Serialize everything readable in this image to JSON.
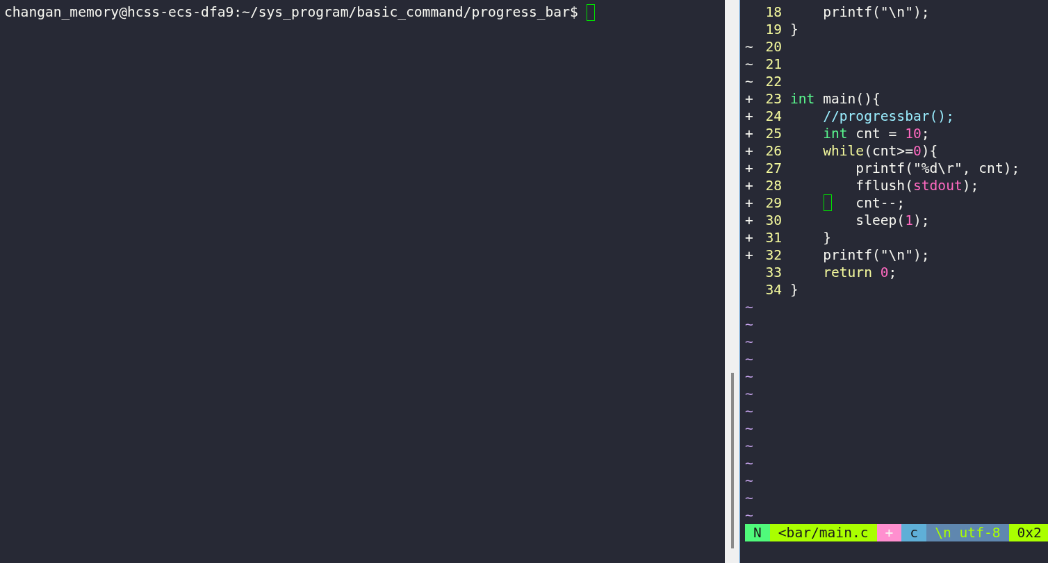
{
  "terminal": {
    "prompt": "changan_memory@hcss-ecs-dfa9:~/sys_program/basic_command/progress_bar$",
    "cursor": true
  },
  "editor": {
    "lines": [
      {
        "number": "18",
        "tokens": [
          {
            "text": "    printf(\"\\n\");",
            "kind": "plain"
          }
        ]
      },
      {
        "number": "19",
        "tokens": [
          {
            "text": "}",
            "kind": "plain"
          }
        ]
      },
      {
        "sign": "~",
        "number": "20"
      },
      {
        "sign": "~",
        "number": "21"
      },
      {
        "sign": "~",
        "number": "22"
      },
      {
        "sign": "+",
        "number": "23",
        "tokens": [
          {
            "text": "int",
            "kind": "type"
          },
          {
            "text": " main(){",
            "kind": "plain"
          }
        ]
      },
      {
        "sign": "+",
        "number": "24",
        "tokens": [
          {
            "text": "    //progressbar();",
            "kind": "comment"
          }
        ]
      },
      {
        "sign": "+",
        "number": "25",
        "tokens": [
          {
            "text": "    int",
            "kind": "type"
          },
          {
            "text": " cnt = ",
            "kind": "plain"
          },
          {
            "text": "10",
            "kind": "number"
          },
          {
            "text": ";",
            "kind": "plain"
          }
        ]
      },
      {
        "sign": "+",
        "number": "26",
        "tokens": [
          {
            "text": "    while",
            "kind": "keyword"
          },
          {
            "text": "(cnt>=",
            "kind": "plain"
          },
          {
            "text": "0",
            "kind": "number"
          },
          {
            "text": "){",
            "kind": "plain"
          }
        ]
      },
      {
        "sign": "+",
        "number": "27",
        "tokens": [
          {
            "text": "        printf(\"%d\\r\", cnt);",
            "kind": "plain"
          }
        ]
      },
      {
        "sign": "+",
        "number": "28",
        "tokens": [
          {
            "text": "        fflush(",
            "kind": "plain"
          },
          {
            "text": "stdout",
            "kind": "number"
          },
          {
            "text": ");",
            "kind": "plain"
          }
        ]
      },
      {
        "sign": "+",
        "number": "29",
        "cursor": true,
        "tokens": [
          {
            "text": "        cnt--;",
            "kind": "plain"
          }
        ]
      },
      {
        "sign": "+",
        "number": "30",
        "tokens": [
          {
            "text": "        sleep(",
            "kind": "plain"
          },
          {
            "text": "1",
            "kind": "number"
          },
          {
            "text": ");",
            "kind": "plain"
          }
        ]
      },
      {
        "sign": "+",
        "number": "31",
        "tokens": [
          {
            "text": "    }",
            "kind": "plain"
          }
        ]
      },
      {
        "sign": "+",
        "number": "32",
        "tokens": [
          {
            "text": "    printf(\"\\n\");",
            "kind": "plain"
          }
        ]
      },
      {
        "number": "33",
        "tokens": [
          {
            "text": "    return ",
            "kind": "keyword"
          },
          {
            "text": "0",
            "kind": "number"
          },
          {
            "text": ";",
            "kind": "plain"
          }
        ]
      },
      {
        "number": "34",
        "tokens": [
          {
            "text": "}",
            "kind": "plain"
          }
        ]
      }
    ],
    "empty_lines": [
      "~",
      "~",
      "~",
      "~",
      "~",
      "~",
      "~",
      "~",
      "~",
      "~",
      "~",
      "~",
      "~"
    ],
    "status_bar": [
      {
        "text": "N",
        "kind": "mode"
      },
      {
        "text": "<bar/main.c",
        "kind": "file"
      },
      {
        "text": "+",
        "kind": "modified"
      },
      {
        "text": "c",
        "kind": "filetype"
      },
      {
        "text": "\\n utf-8",
        "kind": "encoding"
      },
      {
        "text": "0x2",
        "kind": "position"
      }
    ]
  }
}
